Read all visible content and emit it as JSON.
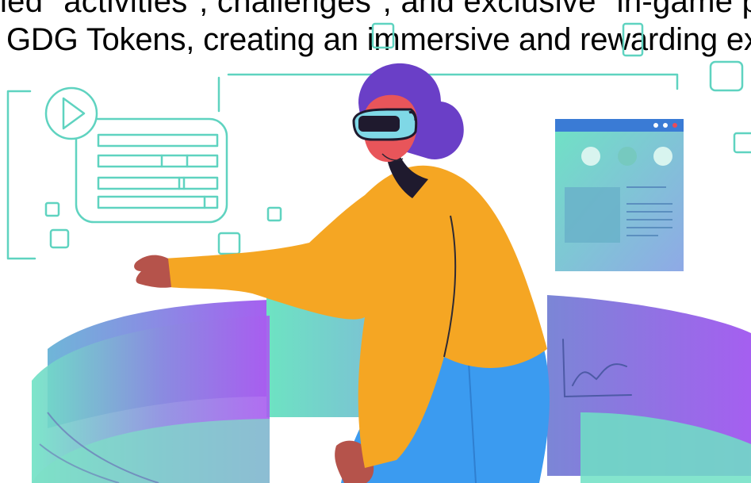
{
  "caption": {
    "line1": "ied \"activities\", challenges\", and exclusive \"in-game pe",
    "line2": "GDG Tokens, creating an immersive and rewarding exp"
  },
  "colors": {
    "ring_teal": "#4fd6be",
    "ring_purple": "#a259ef",
    "shirt": "#f5a623",
    "pants": "#3b9bf0",
    "hair": "#6a3fc7",
    "skin": "#e8555a",
    "ui_line": "#5fd3c0",
    "panel_bar": "#3a7bd5"
  },
  "icons": [
    "play-icon",
    "vr-headset-icon",
    "line-chart-icon"
  ]
}
